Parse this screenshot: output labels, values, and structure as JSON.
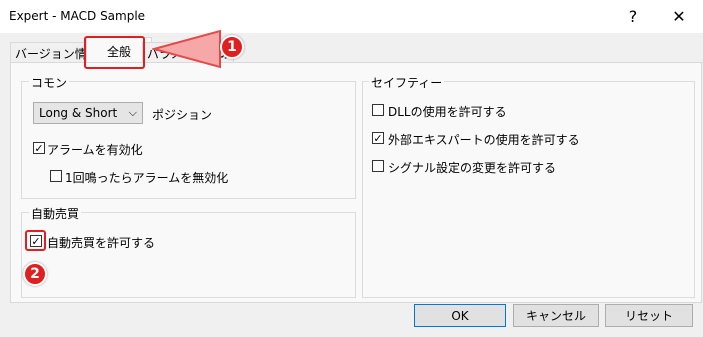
{
  "window": {
    "title": "Expert - MACD Sample",
    "help_icon": "?",
    "close_icon": "✕"
  },
  "tabs": [
    {
      "label": "バージョン情報"
    },
    {
      "label": "全般"
    },
    {
      "label": "パラメーターの入力"
    }
  ],
  "common": {
    "group_label": "コモン",
    "position_select_value": "Long & Short",
    "position_label": "ポジション",
    "enable_alerts": {
      "label": "アラームを有効化",
      "checked": true
    },
    "disable_alert_after_one": {
      "label": "1回鳴ったらアラームを無効化",
      "checked": false
    }
  },
  "auto_trading": {
    "group_label": "自動売買",
    "allow": {
      "label": "自動売買を許可する",
      "checked": true
    }
  },
  "safety": {
    "group_label": "セイフティー",
    "allow_dll": {
      "label": "DLLの使用を許可する",
      "checked": false
    },
    "allow_external_experts": {
      "label": "外部エキスパートの使用を許可する",
      "checked": true
    },
    "allow_signal_changes": {
      "label": "シグナル設定の変更を許可する",
      "checked": false
    }
  },
  "buttons": {
    "ok": "OK",
    "cancel": "キャンセル",
    "reset": "リセット"
  },
  "annotations": {
    "badge1": "1",
    "badge2": "2",
    "accent": "#e02020"
  }
}
